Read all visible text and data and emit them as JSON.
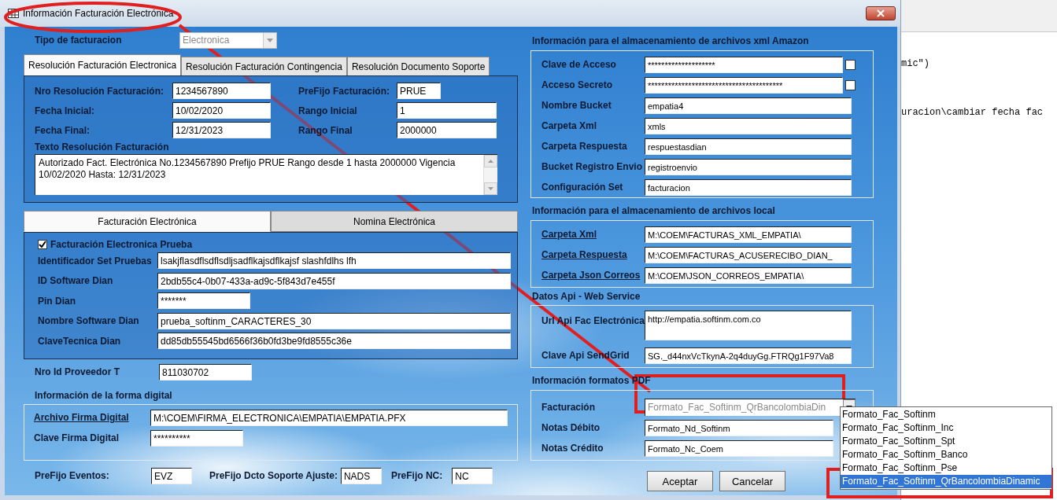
{
  "window": {
    "title": "Información Facturación Electrónica"
  },
  "tipo_facturacion": {
    "label": "Tipo de facturacion",
    "value": "Electronica",
    "disabled": true
  },
  "resolution_tabs": [
    {
      "label": "Resolución Facturación Electronica",
      "selected": true
    },
    {
      "label": "Resolución Facturación Contingencia",
      "selected": false
    },
    {
      "label": "Resolución Documento Soporte",
      "selected": false
    }
  ],
  "resolution_fields": [
    {
      "label": "Nro Resolución Facturación:",
      "value": "1234567890"
    },
    {
      "label": "Fecha Inicial:",
      "value": "10/02/2020"
    },
    {
      "label": "Fecha Final:",
      "value": "12/31/2023"
    }
  ],
  "prefix_fields": [
    {
      "label": "PreFijo Facturación:",
      "value": "PRUE",
      "kind": "short"
    },
    {
      "label": "Rango Inicial",
      "value": "1",
      "kind": "long"
    },
    {
      "label": "Rango Final",
      "value": "2000000",
      "kind": "long"
    }
  ],
  "resolution_text": {
    "label": "Texto Resolución Facturación",
    "value": "Autorizado Fact. Electrónica No.1234567890 Prefijo PRUE Rango desde 1 hasta 2000000 Vigencia 10/02/2020 Hasta: 12/31/2023"
  },
  "billing_tabs": [
    {
      "label": "Facturación Electrónica",
      "selected": true
    },
    {
      "label": "Nomina Electrónica",
      "selected": false
    }
  ],
  "test_mode": {
    "label": "Facturación Electronica Prueba",
    "checked": true
  },
  "dian_fields": [
    {
      "label": "Identificador Set Pruebas",
      "value": "lsakjflasdflsdflsdljsadflkajsdflkajsf slashfdlhs lfh",
      "kind": "long"
    },
    {
      "label": "ID Software Dian",
      "value": "2bdb55c4-0b07-433a-ad9c-5f843d7e455f",
      "kind": "long"
    },
    {
      "label": "Pin Dian",
      "value": "*******",
      "kind": "short"
    },
    {
      "label": "Nombre Software Dian",
      "value": "prueba_softinm_CARACTERES_30",
      "kind": "long"
    },
    {
      "label": "ClaveTecnica Dian",
      "value": "dd85db55545bd6566f36b0fd3be9fd8555c36e",
      "kind": "long"
    }
  ],
  "provider": {
    "label": "Nro Id Proveedor T",
    "value": "811030702"
  },
  "digital_signature": {
    "title": "Información de la forma digital",
    "fields": [
      {
        "label": "Archivo Firma Digital",
        "value": "M:\\COEM\\FIRMA_ELECTRONICA\\EMPATIA\\EMPATIA.PFX",
        "link": true,
        "kind": "long"
      },
      {
        "label": "Clave Firma Digital",
        "value": "**********",
        "link": false,
        "kind": "short"
      }
    ]
  },
  "prefixes": [
    {
      "label": "PreFijo Eventos:",
      "value": "EVZ"
    },
    {
      "label": "PreFijo Dcto Soporte Ajuste:",
      "value": "NADS"
    },
    {
      "label": "PreFijo NC:",
      "value": "NC"
    }
  ],
  "amazon": {
    "title": "Información para el almacenamiento de archivos xml Amazon",
    "fields": [
      {
        "label": "Clave de Acceso",
        "value": "********************",
        "kind": "secret",
        "checked": false
      },
      {
        "label": "Acceso Secreto",
        "value": "****************************************",
        "kind": "secret",
        "checked": false
      },
      {
        "label": "Nombre Bucket",
        "value": "empatia4",
        "kind": "plain"
      },
      {
        "label": "Carpeta Xml",
        "value": "xmls",
        "kind": "plain"
      },
      {
        "label": "Carpeta Respuesta",
        "value": "respuestasdian",
        "kind": "plain"
      },
      {
        "label": "Bucket Registro Envio",
        "value": "registroenvio",
        "kind": "plain"
      },
      {
        "label": "Configuración Set",
        "value": "facturacion",
        "kind": "plain"
      }
    ]
  },
  "local": {
    "title": "Información para el almacenamiento de archivos local",
    "fields": [
      {
        "label": "Carpeta Xml",
        "value": "M:\\COEM\\FACTURAS_XML_EMPATIA\\"
      },
      {
        "label": "Carpeta Respuesta",
        "value": "M:\\COEM\\FACTURAS_ACUSERECIBO_DIAN_"
      },
      {
        "label": "Carpeta Json Correos",
        "value": "M:\\COEM\\JSON_CORREOS_EMPATIA\\"
      }
    ]
  },
  "api": {
    "title": "Datos Api - Web Service",
    "fields": [
      {
        "label": "Url Api Fac Electrónica",
        "value": "http://empatia.softinm.com.co",
        "kind": "tall"
      },
      {
        "label": "Clave Api SendGrid",
        "value": "SG._d44nxVcTkynA-2q4duyGg.FTRQg1F97Va8",
        "kind": "plain"
      }
    ]
  },
  "pdf": {
    "title": "Información formatos PDF",
    "fields": [
      {
        "label": "Facturación",
        "value": "Formato_Fac_Softinm_QrBancolombiaDin",
        "kind": "dropdown"
      },
      {
        "label": "Notas Débito",
        "value": "Formato_Nd_Softinm",
        "kind": "plain"
      },
      {
        "label": "Notas Crédito",
        "value": "Formato_Nc_Coem",
        "kind": "plain"
      }
    ]
  },
  "dropdown_options": [
    {
      "label": "Formato_Fac_Softinm",
      "selected": false
    },
    {
      "label": "Formato_Fac_Softinm_Inc",
      "selected": false
    },
    {
      "label": "Formato_Fac_Softinm_Spt",
      "selected": false
    },
    {
      "label": "Formato_Fac_Softinm_Banco",
      "selected": false
    },
    {
      "label": "Formato_Fac_Softinm_Pse",
      "selected": false
    },
    {
      "label": "Formato_Fac_Softinm_QrBancolombiaDinamic",
      "selected": true
    }
  ],
  "buttons": [
    "Aceptar",
    "Cancelar"
  ],
  "background_editor": {
    "lines": [
      "mic\")",
      "uracion\\cambiar fecha fac"
    ]
  }
}
